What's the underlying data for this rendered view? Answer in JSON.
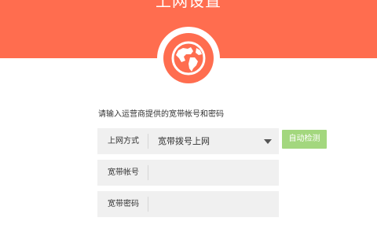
{
  "header": {
    "title": "上网设置",
    "background_color": "#ff6d4f",
    "icon": "globe-icon"
  },
  "form": {
    "prompt": "请输入运营商提供的宽带帐号和密码",
    "connection_type": {
      "label": "上网方式",
      "selected_value": "宽带拨号上网",
      "dropdown_icon": "chevron-down-icon"
    },
    "account": {
      "label": "宽带帐号",
      "value": "",
      "placeholder": ""
    },
    "password": {
      "label": "宽带密码",
      "value": "",
      "placeholder": ""
    },
    "auto_detect_button": {
      "label": "自动检测",
      "color": "#a3d77e"
    }
  }
}
